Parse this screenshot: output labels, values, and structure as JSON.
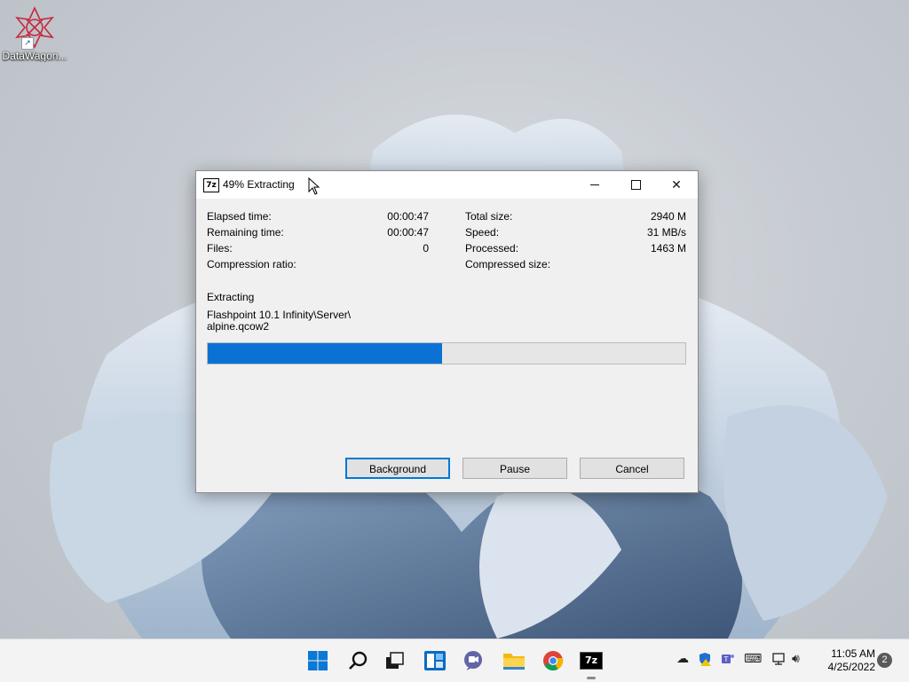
{
  "desktop": {
    "icon_label": "DataWagon..."
  },
  "window": {
    "title": "49% Extracting",
    "app_icon_text": "7z",
    "left": {
      "elapsed_label": "Elapsed time:",
      "elapsed_value": "00:00:47",
      "remaining_label": "Remaining time:",
      "remaining_value": "00:00:47",
      "files_label": "Files:",
      "files_value": "0",
      "ratio_label": "Compression ratio:"
    },
    "right": {
      "total_label": "Total size:",
      "total_value": "2940 M",
      "speed_label": "Speed:",
      "speed_value": "31 MB/s",
      "processed_label": "Processed:",
      "processed_value": "1463 M",
      "compressed_label": "Compressed size:"
    },
    "status_label": "Extracting",
    "path_line1": "Flashpoint 10.1 Infinity\\Server\\",
    "path_line2": "alpine.qcow2",
    "progress_percent": 49,
    "buttons": {
      "background": "Background",
      "pause": "Pause",
      "cancel": "Cancel"
    }
  },
  "taskbar": {
    "time": "11:05 AM",
    "date": "4/25/2022",
    "notification_count": "2",
    "sevenzip_text": "7z"
  },
  "colors": {
    "progress_fill": "#0a72d4",
    "accent": "#0078d7"
  }
}
